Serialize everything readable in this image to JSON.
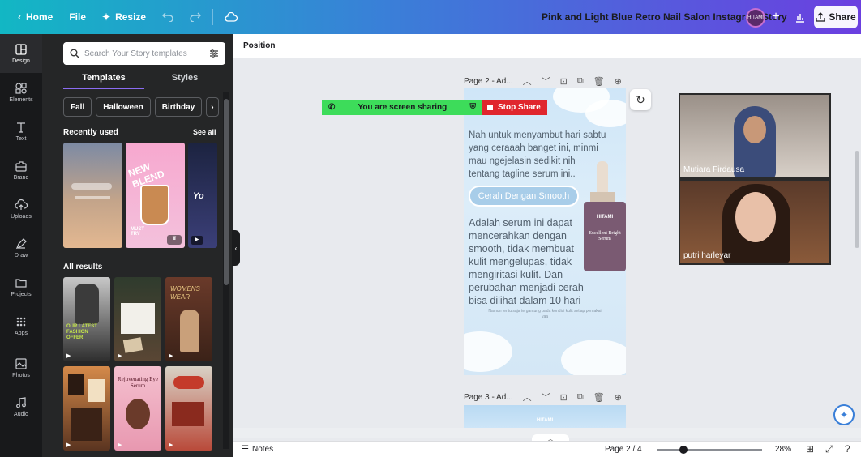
{
  "topbar": {
    "home": "Home",
    "file": "File",
    "resize": "Resize",
    "title": "Pink and Light Blue Retro Nail Salon Instagram Story",
    "brand_avatar": "HITAMI",
    "share": "Share"
  },
  "rail": {
    "items": [
      "Design",
      "Elements",
      "Text",
      "Brand",
      "Uploads",
      "Draw",
      "Projects",
      "Apps",
      "Photos",
      "Audio"
    ]
  },
  "panel": {
    "search_placeholder": "Search Your Story templates",
    "tabs": [
      "Templates",
      "Styles"
    ],
    "chips": [
      "Fall",
      "Halloween",
      "Birthday"
    ],
    "recently_used": "Recently used",
    "see_all": "See all",
    "all_results": "All results",
    "thumb_text": {
      "new_blend": "NEW BLEND",
      "must_try": "MUST TRY",
      "womens_wear": "WOMENS WEAR",
      "latest_fashion": "OUR LATEST FASHION OFFER",
      "rejuvenating": "Rejuvenating Eye Serum"
    }
  },
  "toolbar": {
    "position": "Position"
  },
  "pages": {
    "page2_label": "Page 2 - Ad...",
    "page3_label": "Page 3 - Ad..."
  },
  "page2": {
    "text1": "Nah untuk menyambut hari sabtu yang ceraaah banget ini, minmi mau ngejelasin sedikit nih tentang tagline serum ini..",
    "pill": "Cerah Dengan Smooth",
    "text2": "Adalah serum ini dapat mencerahkan dengan smooth, tidak membuat kulit mengelupas, tidak mengiritasi kulit. Dan perubahan menjadi cerah bisa dilihat dalam 10 hari",
    "small": "Namun tentu saja tergantung pada kondisi kulit setiap pemakai yaa",
    "bottle_brand": "HITAMI",
    "bottle_label": "Excellent Bright Serum"
  },
  "page3": {
    "brand": "HITAMI"
  },
  "sharing": {
    "message": "You are screen sharing",
    "stop": "Stop Share"
  },
  "video": {
    "participants": [
      "Mutiara Firdausa",
      "putri harleyar"
    ]
  },
  "footer": {
    "notes": "Notes",
    "page_indicator": "Page 2 / 4",
    "zoom": "28%",
    "zoom_level": 0.28
  },
  "colors": {
    "topbar_start": "#12b7c4",
    "topbar_end": "#6b3fe0",
    "panel_bg": "#252627",
    "rail_bg": "#18191b",
    "share_green": "#3ddc5a",
    "stop_red": "#e0262d",
    "accent": "#8b6cf2"
  }
}
